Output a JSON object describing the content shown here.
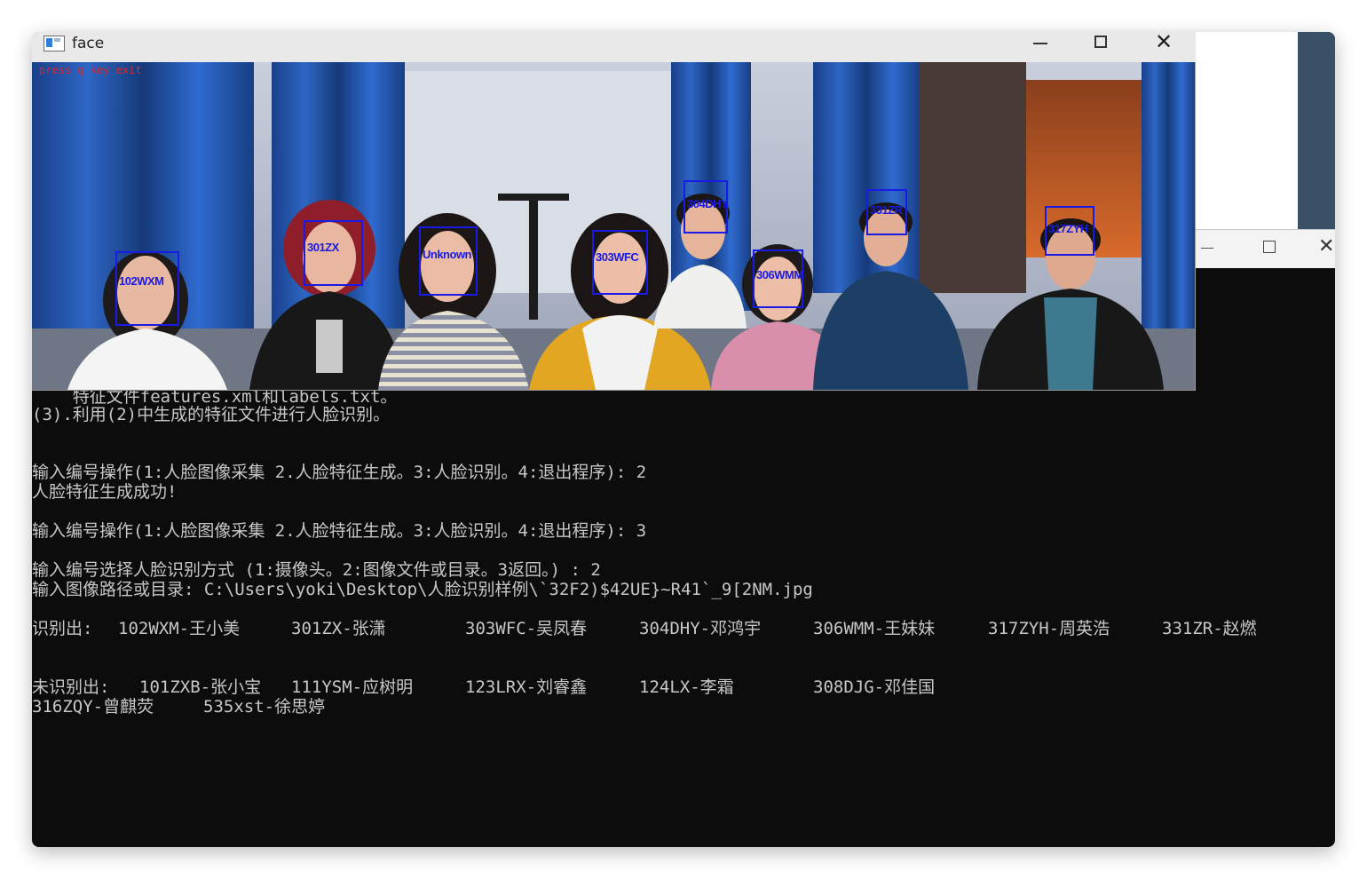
{
  "face_window": {
    "title": "face",
    "overlay_hint": "press q key exit",
    "detections": [
      {
        "label": "102WXM"
      },
      {
        "label": "301ZX"
      },
      {
        "label": "Unknown"
      },
      {
        "label": "303WFC"
      },
      {
        "label": "304DHY"
      },
      {
        "label": "306WMM"
      },
      {
        "label": "331ZR"
      },
      {
        "label": "317ZYH"
      }
    ]
  },
  "console": {
    "lines": [
      "    特征文件features.xml和labels.txt。",
      "(3).利用(2)中生成的特征文件进行人脸识别。",
      "输入编号操作(1:人脸图像采集 2.人脸特征生成。3:人脸识别。4:退出程序): 2",
      "人脸特征生成成功!",
      "输入编号操作(1:人脸图像采集 2.人脸特征生成。3:人脸识别。4:退出程序): 3",
      "输入编号选择人脸识别方式 (1:摄像头。2:图像文件或目录。3返回。) : 2",
      "输入图像路径或目录: C:\\Users\\yoki\\Desktop\\人脸识别样例\\`32F2)$42UE}~R41`_9[2NM.jpg"
    ],
    "recognized_label": "识别出:",
    "recognized": [
      "102WXM-王小美",
      "301ZX-张潇",
      "303WFC-吴凤春",
      "304DHY-邓鸿宇",
      "306WMM-王妹妹",
      "317ZYH-周英浩",
      "331ZR-赵燃"
    ],
    "unrecognized_label": "未识别出:",
    "unrecognized": [
      "101ZXB-张小宝",
      "111YSM-应树明",
      "123LRX-刘睿鑫",
      "124LX-李霜",
      "308DJG-邓佳国",
      "316ZQY-曾麒荧",
      "535xst-徐思婷"
    ]
  },
  "colors": {
    "console_bg": "#0c0c0c",
    "console_text": "#c7c7c7",
    "box": "#1a1ae6",
    "hint": "#d8262a"
  }
}
